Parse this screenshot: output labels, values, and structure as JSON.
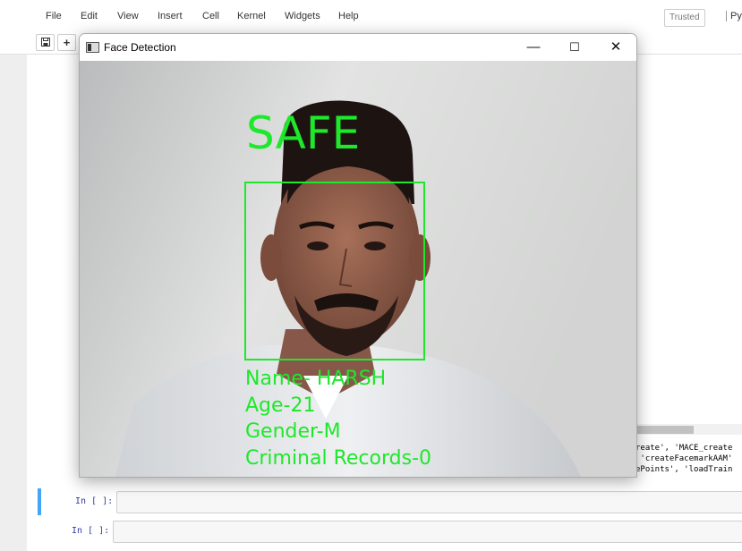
{
  "menu": {
    "file": "File",
    "edit": "Edit",
    "view": "View",
    "insert": "Insert",
    "cell": "Cell",
    "kernel": "Kernel",
    "widgets": "Widgets",
    "help": "Help"
  },
  "status": {
    "trusted": "Trusted",
    "kernel": "Pyt"
  },
  "toolbar": {
    "save_icon": "save-icon",
    "add_label": "+"
  },
  "window": {
    "title": "Face Detection",
    "minimize": "—",
    "maximize": "☐",
    "close": "✕"
  },
  "overlay": {
    "status": "SAFE",
    "name": "Name- HARSH",
    "age": "Age-21",
    "gender": "Gender-M",
    "criminal": "Criminal Records-0",
    "color": "#1ee82a"
  },
  "output": {
    "lines": [
      "reate', 'MACE_create",
      " 'createFacemarkAAM'",
      "ePoints', 'loadTrain"
    ]
  },
  "cells": [
    {
      "prompt": "In [ ]:"
    },
    {
      "prompt": "In [ ]:"
    }
  ]
}
